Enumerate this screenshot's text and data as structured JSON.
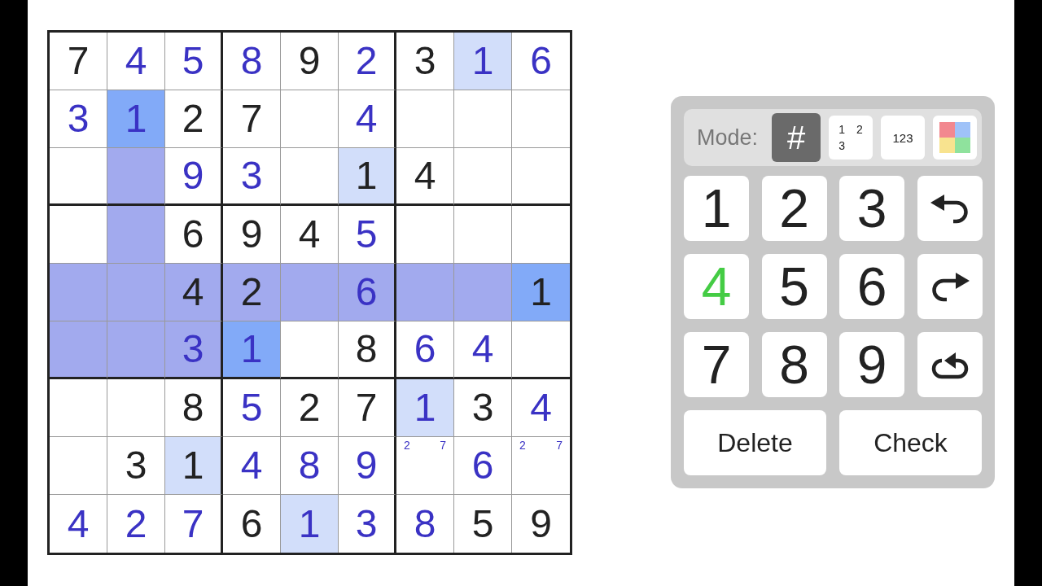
{
  "grid": {
    "rows": [
      [
        {
          "value": "7",
          "given": true,
          "selected": false,
          "highlighted": false
        },
        {
          "value": "4",
          "given": false,
          "selected": false,
          "highlighted": false
        },
        {
          "value": "5",
          "given": false,
          "selected": false,
          "highlighted": false
        },
        {
          "value": "8",
          "given": false,
          "selected": false,
          "highlighted": false
        },
        {
          "value": "9",
          "given": true,
          "selected": false,
          "highlighted": false
        },
        {
          "value": "2",
          "given": false,
          "selected": false,
          "highlighted": false
        },
        {
          "value": "3",
          "given": true,
          "selected": false,
          "highlighted": false
        },
        {
          "value": "1",
          "given": false,
          "selected": false,
          "highlighted": true
        },
        {
          "value": "6",
          "given": false,
          "selected": false,
          "highlighted": false
        }
      ],
      [
        {
          "value": "3",
          "given": false,
          "selected": false,
          "highlighted": false
        },
        {
          "value": "1",
          "given": false,
          "selected": true,
          "highlighted": true
        },
        {
          "value": "2",
          "given": true,
          "selected": false,
          "highlighted": false
        },
        {
          "value": "7",
          "given": true,
          "selected": false,
          "highlighted": false
        },
        {
          "selected": false,
          "highlighted": false
        },
        {
          "value": "4",
          "given": false,
          "selected": false,
          "highlighted": false
        },
        {
          "selected": false,
          "highlighted": false
        },
        {
          "selected": false,
          "highlighted": false
        },
        {
          "selected": false,
          "highlighted": false
        }
      ],
      [
        {
          "selected": false,
          "highlighted": false
        },
        {
          "selected": true,
          "highlighted": false
        },
        {
          "value": "9",
          "given": false,
          "selected": false,
          "highlighted": false
        },
        {
          "value": "3",
          "given": false,
          "selected": false,
          "highlighted": false
        },
        {
          "selected": false,
          "highlighted": false
        },
        {
          "value": "1",
          "given": true,
          "selected": false,
          "highlighted": true
        },
        {
          "value": "4",
          "given": true,
          "selected": false,
          "highlighted": false
        },
        {
          "selected": false,
          "highlighted": false
        },
        {
          "selected": false,
          "highlighted": false
        }
      ],
      [
        {
          "selected": false,
          "highlighted": false
        },
        {
          "selected": true,
          "highlighted": false
        },
        {
          "value": "6",
          "given": true,
          "selected": false,
          "highlighted": false
        },
        {
          "value": "9",
          "given": true,
          "selected": false,
          "highlighted": false
        },
        {
          "value": "4",
          "given": true,
          "selected": false,
          "highlighted": false
        },
        {
          "value": "5",
          "given": false,
          "selected": false,
          "highlighted": false
        },
        {
          "selected": false,
          "highlighted": false
        },
        {
          "selected": false,
          "highlighted": false
        },
        {
          "selected": false,
          "highlighted": false
        }
      ],
      [
        {
          "selected": true,
          "highlighted": false
        },
        {
          "selected": true,
          "highlighted": false
        },
        {
          "value": "4",
          "given": true,
          "selected": true,
          "highlighted": false
        },
        {
          "value": "2",
          "given": true,
          "selected": true,
          "highlighted": false
        },
        {
          "selected": true,
          "highlighted": false
        },
        {
          "value": "6",
          "given": false,
          "selected": true,
          "highlighted": false
        },
        {
          "selected": true,
          "highlighted": false
        },
        {
          "selected": true,
          "highlighted": false
        },
        {
          "value": "1",
          "given": true,
          "selected": true,
          "highlighted": true
        }
      ],
      [
        {
          "selected": true,
          "highlighted": false
        },
        {
          "selected": true,
          "highlighted": false
        },
        {
          "value": "3",
          "given": false,
          "selected": true,
          "highlighted": false
        },
        {
          "value": "1",
          "given": false,
          "selected": true,
          "highlighted": true
        },
        {
          "selected": false,
          "highlighted": false
        },
        {
          "value": "8",
          "given": true,
          "selected": false,
          "highlighted": false
        },
        {
          "value": "6",
          "given": false,
          "selected": false,
          "highlighted": false
        },
        {
          "value": "4",
          "given": false,
          "selected": false,
          "highlighted": false
        },
        {
          "selected": false,
          "highlighted": false
        }
      ],
      [
        {
          "selected": false,
          "highlighted": false
        },
        {
          "selected": false,
          "highlighted": false
        },
        {
          "value": "8",
          "given": true,
          "selected": false,
          "highlighted": false
        },
        {
          "value": "5",
          "given": false,
          "selected": false,
          "highlighted": false
        },
        {
          "value": "2",
          "given": true,
          "selected": false,
          "highlighted": false
        },
        {
          "value": "7",
          "given": true,
          "selected": false,
          "highlighted": false
        },
        {
          "value": "1",
          "given": false,
          "selected": false,
          "highlighted": true
        },
        {
          "value": "3",
          "given": true,
          "selected": false,
          "highlighted": false
        },
        {
          "value": "4",
          "given": false,
          "selected": false,
          "highlighted": false
        }
      ],
      [
        {
          "selected": false,
          "highlighted": false
        },
        {
          "value": "3",
          "given": true,
          "selected": false,
          "highlighted": false
        },
        {
          "value": "1",
          "given": true,
          "selected": false,
          "highlighted": true
        },
        {
          "value": "4",
          "given": false,
          "selected": false,
          "highlighted": false
        },
        {
          "value": "8",
          "given": false,
          "selected": false,
          "highlighted": false
        },
        {
          "value": "9",
          "given": false,
          "selected": false,
          "highlighted": false
        },
        {
          "marks": [
            "2",
            "7"
          ],
          "selected": false,
          "highlighted": false
        },
        {
          "value": "6",
          "given": false,
          "selected": false,
          "highlighted": false
        },
        {
          "marks": [
            "2",
            "7"
          ],
          "selected": false,
          "highlighted": false
        }
      ],
      [
        {
          "value": "4",
          "given": false,
          "selected": false,
          "highlighted": false
        },
        {
          "value": "2",
          "given": false,
          "selected": false,
          "highlighted": false
        },
        {
          "value": "7",
          "given": false,
          "selected": false,
          "highlighted": false
        },
        {
          "value": "6",
          "given": true,
          "selected": false,
          "highlighted": false
        },
        {
          "value": "1",
          "given": false,
          "selected": false,
          "highlighted": true
        },
        {
          "value": "3",
          "given": false,
          "selected": false,
          "highlighted": false
        },
        {
          "value": "8",
          "given": false,
          "selected": false,
          "highlighted": false
        },
        {
          "value": "5",
          "given": true,
          "selected": false,
          "highlighted": false
        },
        {
          "value": "9",
          "given": true,
          "selected": false,
          "highlighted": false
        }
      ]
    ]
  },
  "keypad": {
    "mode_label": "Mode:",
    "modes": [
      {
        "kind": "normal",
        "label": "#",
        "selected": true
      },
      {
        "kind": "corner",
        "marks": [
          "1",
          "2",
          "3"
        ],
        "selected": false
      },
      {
        "kind": "center",
        "label": "123",
        "selected": false
      },
      {
        "kind": "color",
        "selected": false
      }
    ],
    "keys": [
      {
        "kind": "digit",
        "label": "1",
        "complete": false
      },
      {
        "kind": "digit",
        "label": "2",
        "complete": false
      },
      {
        "kind": "digit",
        "label": "3",
        "complete": false
      },
      {
        "kind": "undo"
      },
      {
        "kind": "digit",
        "label": "4",
        "complete": true
      },
      {
        "kind": "digit",
        "label": "5",
        "complete": false
      },
      {
        "kind": "digit",
        "label": "6",
        "complete": false
      },
      {
        "kind": "redo"
      },
      {
        "kind": "digit",
        "label": "7",
        "complete": false
      },
      {
        "kind": "digit",
        "label": "8",
        "complete": false
      },
      {
        "kind": "digit",
        "label": "9",
        "complete": false
      },
      {
        "kind": "restart"
      }
    ],
    "buttons": [
      {
        "label": "Delete"
      },
      {
        "label": "Check"
      }
    ]
  }
}
